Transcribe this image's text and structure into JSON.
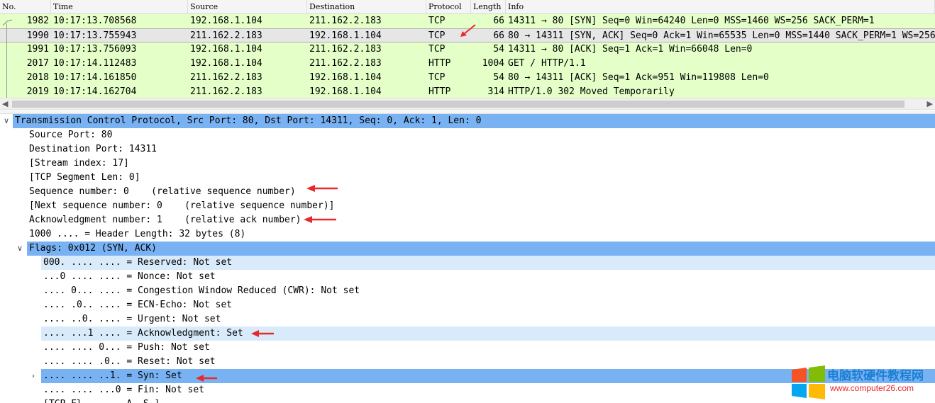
{
  "packet_list": {
    "columns": [
      "No.",
      "Time",
      "Source",
      "Destination",
      "Protocol",
      "Length",
      "Info"
    ],
    "rows": [
      {
        "no": "1982",
        "time": "10:17:13.708568",
        "src": "192.168.1.104",
        "dst": "211.162.2.183",
        "proto": "TCP",
        "len": "66",
        "info": "14311 → 80 [SYN] Seq=0 Win=64240 Len=0 MSS=1460 WS=256 SACK_PERM=1"
      },
      {
        "no": "1990",
        "time": "10:17:13.755943",
        "src": "211.162.2.183",
        "dst": "192.168.1.104",
        "proto": "TCP",
        "len": "66",
        "info": "80 → 14311 [SYN, ACK] Seq=0 Ack=1 Win=65535 Len=0 MSS=1440 SACK_PERM=1 WS=256"
      },
      {
        "no": "1991",
        "time": "10:17:13.756093",
        "src": "192.168.1.104",
        "dst": "211.162.2.183",
        "proto": "TCP",
        "len": "54",
        "info": "14311 → 80 [ACK] Seq=1 Ack=1 Win=66048 Len=0"
      },
      {
        "no": "2017",
        "time": "10:17:14.112483",
        "src": "192.168.1.104",
        "dst": "211.162.2.183",
        "proto": "HTTP",
        "len": "1004",
        "info": "GET / HTTP/1.1"
      },
      {
        "no": "2018",
        "time": "10:17:14.161850",
        "src": "211.162.2.183",
        "dst": "192.168.1.104",
        "proto": "TCP",
        "len": "54",
        "info": "80 → 14311 [ACK] Seq=1 Ack=951 Win=119808 Len=0"
      },
      {
        "no": "2019",
        "time": "10:17:14.162704",
        "src": "211.162.2.183",
        "dst": "192.168.1.104",
        "proto": "HTTP",
        "len": "314",
        "info": "HTTP/1.0 302 Moved Temporarily"
      }
    ]
  },
  "details": {
    "tcp_header": "Transmission Control Protocol, Src Port: 80, Dst Port: 14311, Seq: 0, Ack: 1, Len: 0",
    "source_port": "Source Port: 80",
    "destination_port": "Destination Port: 14311",
    "stream_index": "[Stream index: 17]",
    "segment_len": "[TCP Segment Len: 0]",
    "seq_number": "Sequence number: 0    (relative sequence number)",
    "next_seq": "[Next sequence number: 0    (relative sequence number)]",
    "ack_number": "Acknowledgment number: 1    (relative ack number)",
    "header_length": "1000 .... = Header Length: 32 bytes (8)",
    "flags_header": "Flags: 0x012 (SYN, ACK)",
    "flags": {
      "reserved": "000. .... .... = Reserved: Not set",
      "nonce": "...0 .... .... = Nonce: Not set",
      "cwr": ".... 0... .... = Congestion Window Reduced (CWR): Not set",
      "ecn": ".... .0.. .... = ECN-Echo: Not set",
      "urgent": ".... ..0. .... = Urgent: Not set",
      "ack": ".... ...1 .... = Acknowledgment: Set",
      "push": ".... .... 0... = Push: Not set",
      "reset": ".... .... .0.. = Reset: Not set",
      "syn": ".... .... ..1. = Syn: Set",
      "fin": ".... .... ...0 = Fin: Not set",
      "tcp_flags_partial": "[TCP Fl........A..S.]"
    }
  },
  "watermark": {
    "title": "电脑软硬件教程网",
    "url": "www.computer26.com"
  },
  "colors": {
    "row_tcp_bg": "#e4ffc7",
    "row_selected_bg": "#e6e6e6",
    "tree_selected_bg": "#79b2f3",
    "tree_highlight_bg": "#d9ebfb",
    "annotation_red": "#e8282b"
  }
}
